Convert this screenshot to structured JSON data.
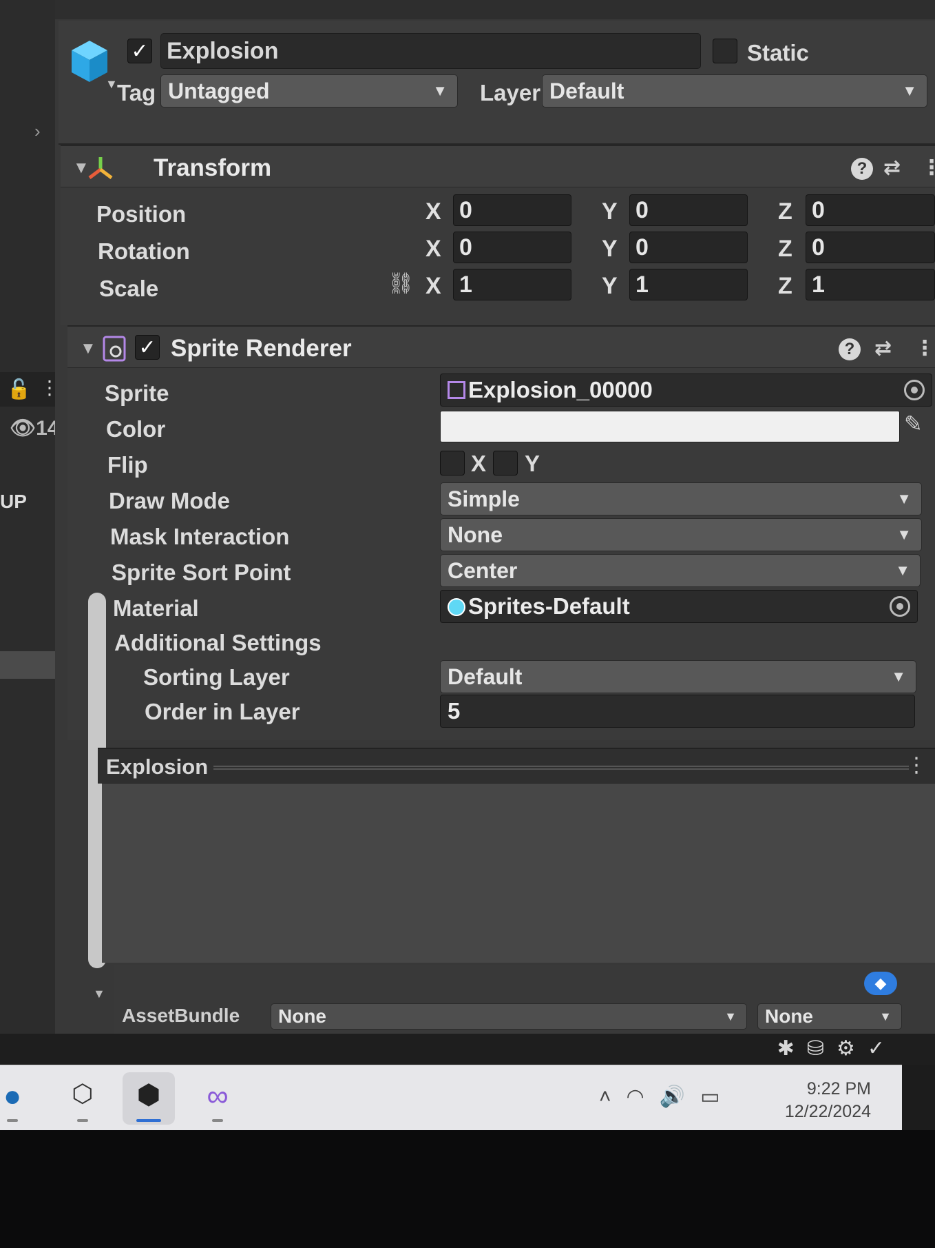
{
  "object": {
    "name": "Explosion",
    "active": true,
    "static_label": "Static",
    "tag_label": "Tag",
    "tag_value": "Untagged",
    "layer_label": "Layer",
    "layer_value": "Default"
  },
  "transform": {
    "title": "Transform",
    "rows": [
      {
        "label": "Position",
        "x": "0",
        "y": "0",
        "z": "0"
      },
      {
        "label": "Rotation",
        "x": "0",
        "y": "0",
        "z": "0"
      },
      {
        "label": "Scale",
        "x": "1",
        "y": "1",
        "z": "1"
      }
    ],
    "axis_x": "X",
    "axis_y": "Y",
    "axis_z": "Z"
  },
  "sprite_renderer": {
    "title": "Sprite Renderer",
    "enabled": true,
    "sprite_label": "Sprite",
    "sprite_value": "Explosion_00000",
    "color_label": "Color",
    "color_value": "#f0f0f0",
    "flip_label": "Flip",
    "flip_x": "X",
    "flip_y": "Y",
    "draw_mode_label": "Draw Mode",
    "draw_mode_value": "Simple",
    "mask_label": "Mask Interaction",
    "mask_value": "None",
    "sort_point_label": "Sprite Sort Point",
    "sort_point_value": "Center",
    "material_label": "Material",
    "material_value": "Sprites-Default",
    "additional_label": "Additional Settings",
    "sorting_layer_label": "Sorting Layer",
    "sorting_layer_value": "Default",
    "order_label": "Order in Layer",
    "order_value": "5"
  },
  "preview": {
    "title": "Explosion"
  },
  "asset_bundle": {
    "label": "AssetBundle",
    "name_value": "None",
    "variant_value": "None"
  },
  "hierarchy": {
    "visible_count": "14",
    "partial_label": "UP"
  },
  "taskbar": {
    "time": "9:22 PM",
    "date": "12/22/2024"
  }
}
